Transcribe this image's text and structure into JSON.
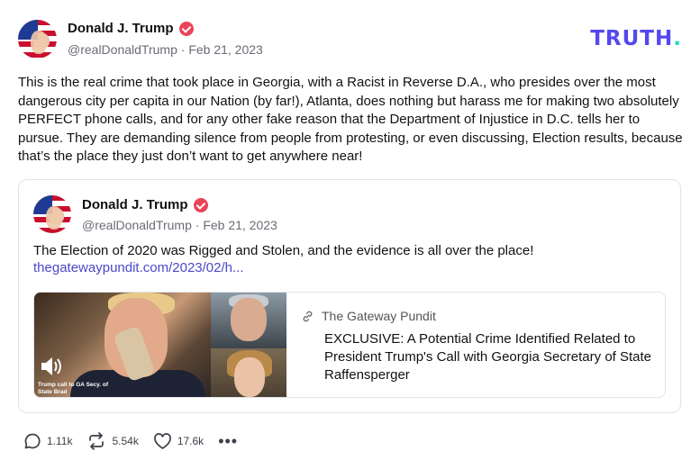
{
  "post": {
    "author_name": "Donald J. Trump",
    "handle": "@realDonaldTrump",
    "separator": "·",
    "date": "Feb 21, 2023",
    "text": "This is the real crime that took place in Georgia, with a Racist in Reverse D.A., who presides over the most dangerous city per capita in our Nation (by far!), Atlanta, does nothing but harass me for making two absolutely PERFECT phone calls, and for any other fake reason that the Department of Injustice in D.C. tells her to pursue. They are demanding silence from people from protesting, or even discussing, Election results, because that’s the place they just don’t want to get anywhere near!"
  },
  "logo": {
    "text": "TRUTH",
    "dot": ".",
    "color": "#5448ee",
    "dot_color": "#2ad6c4"
  },
  "quoted": {
    "author_name": "Donald J. Trump",
    "handle": "@realDonaldTrump",
    "separator": "·",
    "date": "Feb 21, 2023",
    "text": "The Election of 2020 was Rigged and Stolen, and the evidence is all over the place!",
    "link": "thegatewaypundit.com/2023/02/h...",
    "card": {
      "site": "The Gateway Pundit",
      "title": "EXCLUSIVE: A Potential Crime Identified Related to President Trump's Call with Georgia Secretary of State Raffensperger",
      "image_caption": "Trump call to GA Secy. of State Brad"
    }
  },
  "actions": {
    "replies": "1.11k",
    "reposts": "5.54k",
    "likes": "17.6k",
    "more": "•••"
  },
  "colors": {
    "verified": "#e8445a",
    "link": "#4a49c8",
    "muted": "#6b6b76"
  },
  "icons": [
    "verified-badge-icon",
    "link-icon",
    "reply-icon",
    "repost-icon",
    "like-icon",
    "more-icon",
    "speaker-icon"
  ]
}
